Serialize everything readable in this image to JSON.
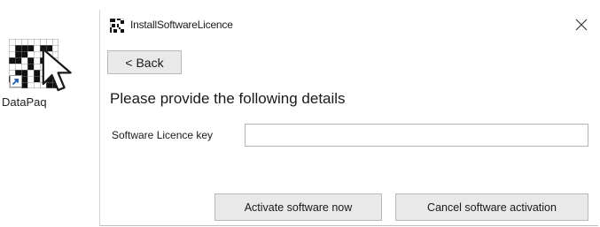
{
  "desktop": {
    "icon_label": "DataPaq",
    "icon_name": "datapaq-app-icon",
    "cursor_icon": "pointer-cursor-icon"
  },
  "dialog": {
    "title": "InstallSoftwareLicence",
    "title_icon": "datapaq-small-icon",
    "close_icon": "close-icon",
    "close_glyph": "✕",
    "back_label": "< Back",
    "heading": "Please provide the following details",
    "licence_field": {
      "label": "Software Licence key",
      "value": "",
      "placeholder": ""
    },
    "buttons": {
      "activate_label": "Activate software now",
      "cancel_label": "Cancel  software activation"
    }
  },
  "colors": {
    "button_bg": "#e9e9e9",
    "button_border": "#b9b9b9",
    "input_border": "#b4b4b4",
    "text": "#1a1a1a"
  }
}
